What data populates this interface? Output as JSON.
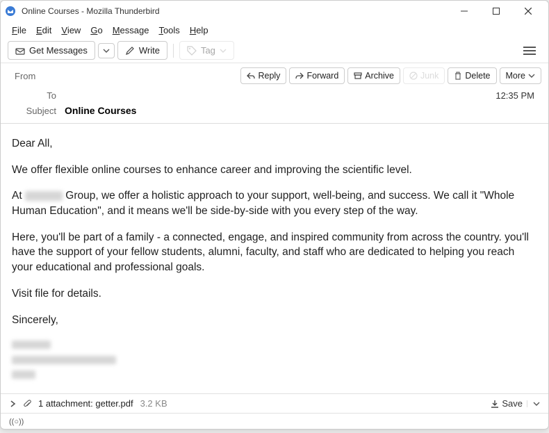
{
  "window": {
    "title": "Online Courses - Mozilla Thunderbird"
  },
  "menu": {
    "file": "File",
    "edit": "Edit",
    "view": "View",
    "go": "Go",
    "message": "Message",
    "tools": "Tools",
    "help": "Help"
  },
  "toolbar": {
    "get_messages": "Get Messages",
    "write": "Write",
    "tag": "Tag"
  },
  "header": {
    "from_label": "From",
    "to_label": "To",
    "subject_label": "Subject",
    "subject_value": "Online Courses",
    "time": "12:35 PM"
  },
  "actions": {
    "reply": "Reply",
    "forward": "Forward",
    "archive": "Archive",
    "junk": "Junk",
    "delete": "Delete",
    "more": "More"
  },
  "body": {
    "p1": "Dear All,",
    "p2": "We offer flexible online courses to enhance career and improving the scientific level.",
    "p3a": "At ",
    "p3b": " Group, we offer a holistic approach to your support, well-being, and success. We call it \"Whole Human Education\", and it means we'll be side-by-side with you every step of the way.",
    "p4": "Here, you'll be part of a family - a connected, engage, and inspired community from across the country. you'll have the support of your fellow students, alumni, faculty, and staff who are dedicated to helping you reach your educational and professional goals.",
    "p5": "Visit file for details.",
    "p6": "Sincerely,"
  },
  "attachment": {
    "label": "1 attachment: getter.pdf",
    "size": "3.2 KB",
    "save": "Save"
  },
  "status": {
    "text": "((○))"
  }
}
